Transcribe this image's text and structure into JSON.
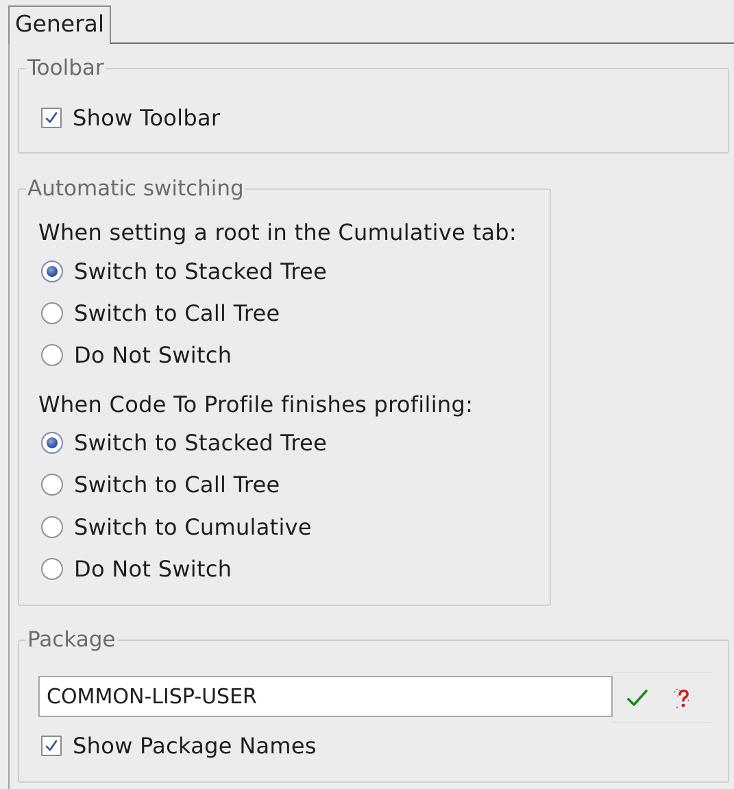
{
  "tabs": [
    {
      "label": "General",
      "active": true
    }
  ],
  "toolbar_group": {
    "legend": "Toolbar",
    "show_toolbar": {
      "label": "Show Toolbar",
      "checked": true
    }
  },
  "auto_switching": {
    "legend": "Automatic switching",
    "cumulative_prompt": "When setting a root in the Cumulative tab:",
    "cumulative_options": [
      {
        "label": "Switch to Stacked Tree",
        "selected": true
      },
      {
        "label": "Switch to Call Tree",
        "selected": false
      },
      {
        "label": "Do Not Switch",
        "selected": false
      }
    ],
    "profile_prompt": "When Code To Profile finishes profiling:",
    "profile_options": [
      {
        "label": "Switch to Stacked Tree",
        "selected": true
      },
      {
        "label": "Switch to Call Tree",
        "selected": false
      },
      {
        "label": "Switch to Cumulative",
        "selected": false
      },
      {
        "label": "Do Not Switch",
        "selected": false
      }
    ]
  },
  "package_group": {
    "legend": "Package",
    "value": "COMMON-LISP-USER",
    "confirm_icon": "checkmark-icon",
    "help_icon": "question-help-icon",
    "show_package_names": {
      "label": "Show Package Names",
      "checked": true
    }
  },
  "colors": {
    "background": "#ececec",
    "legend_text": "#6c6c6c",
    "check_green": "#1c8a1c",
    "radio_blue": "#2f4f9e",
    "help_red": "#d01818"
  }
}
